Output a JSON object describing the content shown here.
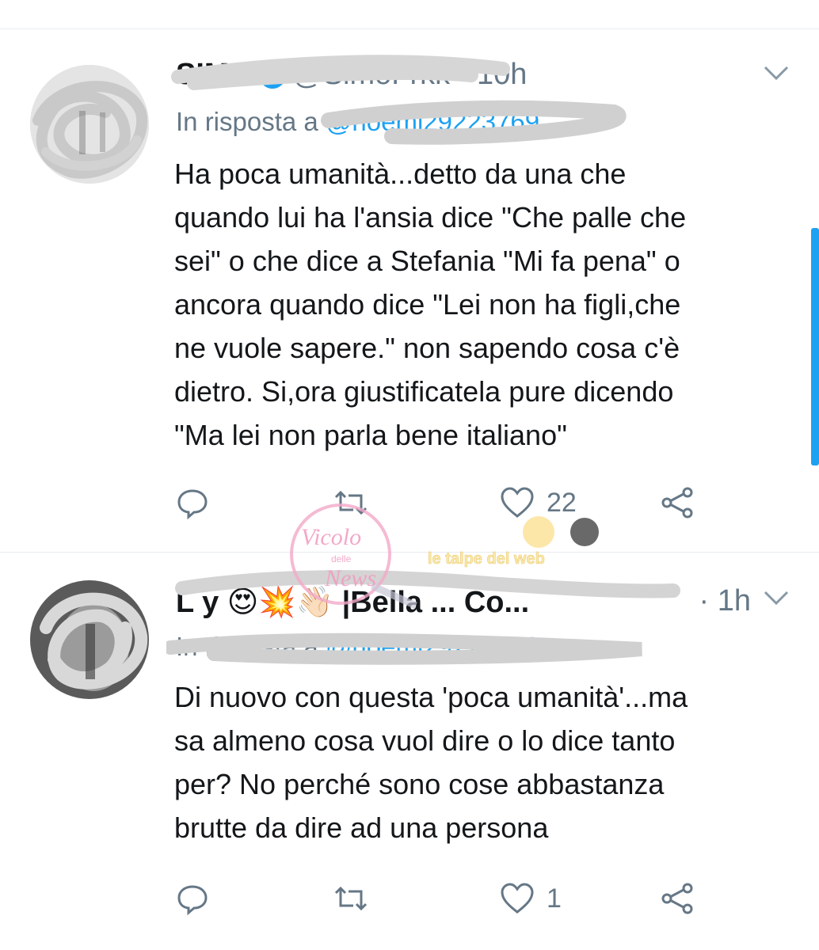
{
  "tweets": [
    {
      "display_name": "SIMO",
      "handle": "@SimoFrkk",
      "separator": "·",
      "time": "10h",
      "reply_prefix": "In risposta a",
      "reply_handle": "@noemi29223769",
      "text": "Ha poca umanità...detto da una che\nquando lui ha l'ansia dice \"Che palle che\nsei\" o che dice a Stefania \"Mi fa pena\" o\nancora quando dice \"Lei non ha figli,che\nne vuole sapere.\" non sapendo cosa c'è\ndietro. Si,ora giustificatela pure dicendo\n\"Ma lei non parla bene italiano\"",
      "reply_count": "",
      "retweet_count": "",
      "like_count": "22"
    },
    {
      "display_name": "L y 😍💥👋🏻 |Bella ... Co...",
      "separator": "·",
      "time": "1h",
      "reply_prefix": "In risposta a",
      "reply_handle": "@noemi29223769",
      "text": "Di nuovo con questa 'poca umanità'...ma\nsa almeno cosa vuol dire o lo dice tanto\nper? No perché sono cose abbastanza\nbrutte da dire ad una persona",
      "reply_count": "",
      "retweet_count": "",
      "like_count": "1"
    }
  ],
  "icons": {
    "reply": "reply-icon",
    "retweet": "retweet-icon",
    "like": "heart-icon",
    "share": "share-icon",
    "menu": "chevron-down-icon",
    "verified": "verified-badge-icon"
  },
  "watermark": {
    "line1": "Vicolo",
    "line2": "delle",
    "line3": "News",
    "tagline": "le talpe del web"
  },
  "colors": {
    "accent": "#1da1f2",
    "secondary_text": "#657786",
    "primary_text": "#14171a",
    "divider": "#e6ecf0",
    "scribble": "#cfcfcf"
  }
}
